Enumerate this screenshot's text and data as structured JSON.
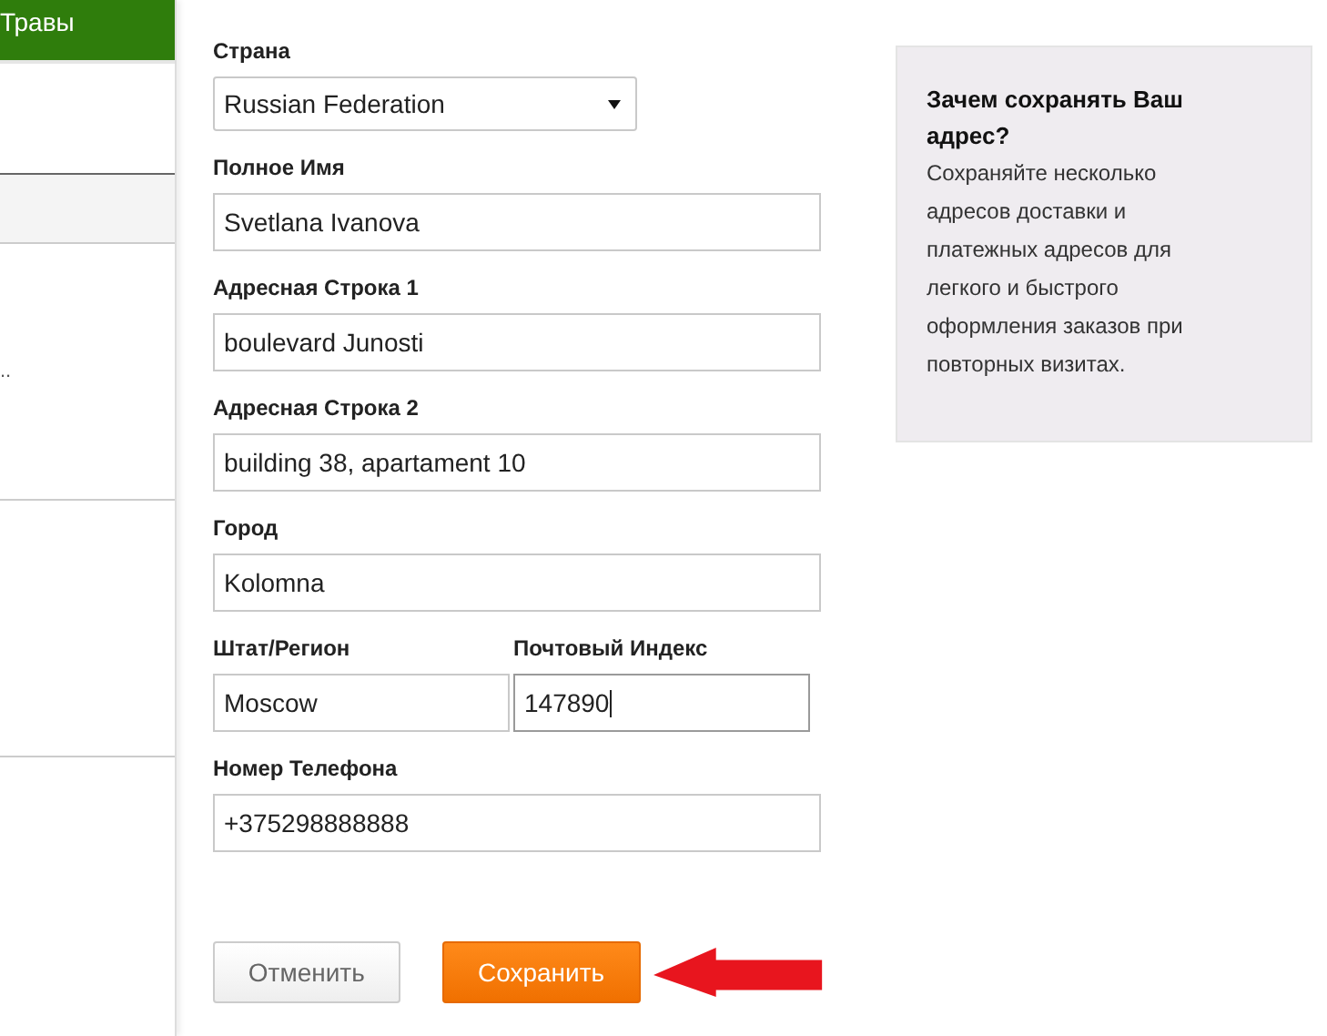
{
  "sidebar": {
    "header": "Травы",
    "items": [
      {
        "shaded": true
      },
      {
        "label": "..",
        "shaded": false
      },
      {
        "shaded": false
      },
      {
        "shaded": false
      }
    ]
  },
  "form": {
    "rows": [
      {
        "fields": [
          {
            "kind": "select",
            "label": "Страна",
            "value": "Russian Federation",
            "focused": false
          }
        ]
      },
      {
        "fields": [
          {
            "kind": "text",
            "label": "Полное Имя",
            "value": "Svetlana Ivanova",
            "focused": false
          }
        ]
      },
      {
        "fields": [
          {
            "kind": "text",
            "label": "Адресная Строка 1",
            "value": "boulevard Junosti",
            "focused": false
          }
        ]
      },
      {
        "fields": [
          {
            "kind": "text",
            "label": "Адресная Строка 2",
            "value": "building 38, apartament 10",
            "focused": false
          }
        ]
      },
      {
        "fields": [
          {
            "kind": "text",
            "label": "Город",
            "value": "Kolomna",
            "focused": false
          }
        ]
      },
      {
        "fields": [
          {
            "kind": "half",
            "label": "Штат/Регион",
            "value": "Moscow",
            "focused": false
          },
          {
            "kind": "half",
            "label": "Почтовый Индекс",
            "value": "147890",
            "focused": true
          }
        ]
      },
      {
        "fields": [
          {
            "kind": "text",
            "label": "Номер Телефона",
            "value": "+375298888888",
            "focused": false
          }
        ]
      }
    ],
    "buttons": [
      {
        "kind": "secondary",
        "label": "Отменить"
      },
      {
        "kind": "primary",
        "label": "Сохранить"
      }
    ]
  },
  "info": {
    "title": "Зачем сохранять Ваш адрес?",
    "text": "Сохраняйте несколько адресов доставки и платежных адресов для легкого и быстрого оформления заказов при повторных визитах."
  }
}
